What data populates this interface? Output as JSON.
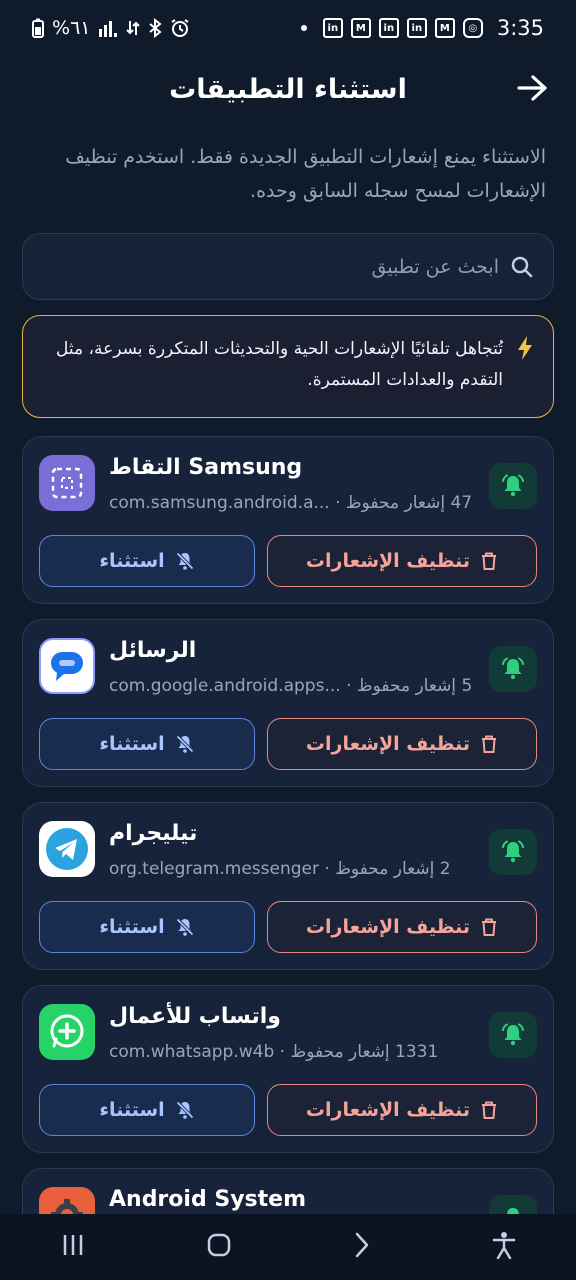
{
  "status_bar": {
    "time": "3:35",
    "battery": "%٦١",
    "left_icons": [
      "battery-icon",
      "signal-icon",
      "data-icon",
      "bluetooth-icon",
      "alarm-icon"
    ],
    "right_icons": [
      "dot-icon",
      "linkedin-icon",
      "gmail-icon",
      "linkedin-icon",
      "linkedin-icon",
      "gmail-icon",
      "instagram-icon"
    ]
  },
  "header": {
    "title": "استثناء التطبيقات",
    "back_icon": "arrow-back-icon"
  },
  "description": "الاستثناء يمنع إشعارات التطبيق الجديدة فقط. استخدم تنظيف الإشعارات لمسح سجله السابق وحده.",
  "search": {
    "placeholder": "ابحث عن تطبيق",
    "value": ""
  },
  "notice": {
    "icon": "lightning-icon",
    "text": "تُتجاهل تلقائيًا الإشعارات الحية والتحديثات المتكررة بسرعة، مثل التقدم والعدادات المستمرة."
  },
  "colors": {
    "background": "#0f1a2b",
    "card": "#17233a",
    "accent_green": "#2ecf7f",
    "clear_red": "#f4a49a",
    "exclude_blue": "#a9c4ff",
    "notice_border": "#e4b73e"
  },
  "apps": [
    {
      "name": "Samsung التقاط",
      "count": "47 إشعار محفوظ",
      "package": "com.samsung.android.a...",
      "icon": "samsung-capture-icon",
      "clear_label": "تنظيف الإشعارات",
      "exclude_label": "استثناء"
    },
    {
      "name": "الرسائل",
      "count": "5 إشعار محفوظ",
      "package": "com.google.android.apps...",
      "icon": "google-messages-icon",
      "clear_label": "تنظيف الإشعارات",
      "exclude_label": "استثناء"
    },
    {
      "name": "تيليجرام",
      "count": "2 إشعار محفوظ",
      "package": "org.telegram.messenger",
      "icon": "telegram-icon",
      "clear_label": "تنظيف الإشعارات",
      "exclude_label": "استثناء"
    },
    {
      "name": "واتساب للأعمال",
      "count": "1331 إشعار محفوظ",
      "package": "com.whatsapp.w4b",
      "icon": "whatsapp-business-icon",
      "clear_label": "تنظيف الإشعارات",
      "exclude_label": "استثناء"
    },
    {
      "name": "Android System",
      "icon": "android-system-icon"
    }
  ],
  "nav_bar": [
    "recents-icon",
    "home-icon",
    "back-icon",
    "accessibility-icon"
  ]
}
